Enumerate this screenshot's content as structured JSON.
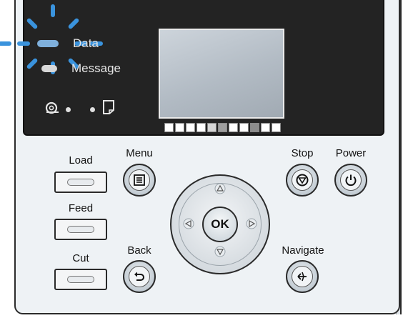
{
  "status": {
    "data_label": "Data",
    "message_label": "Message"
  },
  "buttons": {
    "load": "Load",
    "feed": "Feed",
    "cut": "Cut",
    "menu": "Menu",
    "back": "Back",
    "ok": "OK",
    "stop": "Stop",
    "power": "Power",
    "navigate": "Navigate"
  },
  "colors": {
    "display_bg": "#232323",
    "panel_bg": "#eef2f5",
    "data_lamp_blink": "#3a93dd"
  },
  "icons": {
    "ink_roll": "ink-roll-icon",
    "paper": "paper-icon",
    "menu": "list-icon",
    "back": "return-arrow-icon",
    "stop": "stop-icon",
    "power": "power-icon",
    "navigate": "navigate-icon"
  }
}
